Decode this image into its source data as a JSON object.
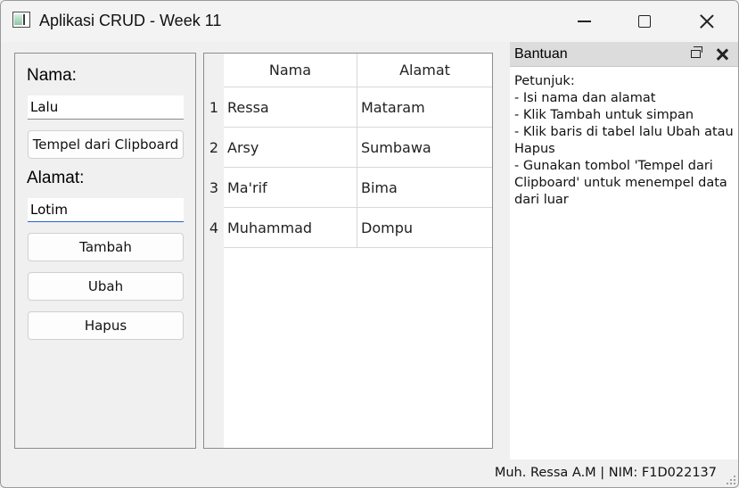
{
  "window": {
    "title": "Aplikasi CRUD - Week 11"
  },
  "form": {
    "nama_label": "Nama:",
    "nama_value": "Lalu",
    "paste_button": "Tempel dari Clipboard",
    "alamat_label": "Alamat:",
    "alamat_value": "Lotim",
    "tambah_button": "Tambah",
    "ubah_button": "Ubah",
    "hapus_button": "Hapus"
  },
  "table": {
    "headers": [
      "Nama",
      "Alamat"
    ],
    "rows": [
      {
        "num": "1",
        "nama": "Ressa",
        "alamat": "Mataram"
      },
      {
        "num": "2",
        "nama": "Arsy",
        "alamat": "Sumbawa"
      },
      {
        "num": "3",
        "nama": "Ma'rif",
        "alamat": "Bima"
      },
      {
        "num": "4",
        "nama": "Muhammad",
        "alamat": "Dompu"
      }
    ]
  },
  "help": {
    "title": "Bantuan",
    "lines": [
      "Petunjuk:",
      "- Isi nama dan alamat",
      "- Klik Tambah untuk simpan",
      "- Klik baris di tabel lalu Ubah atau",
      "Hapus",
      "- Gunakan tombol 'Tempel dari",
      "Clipboard' untuk menempel data",
      "dari luar"
    ]
  },
  "status": {
    "text": "Muh. Ressa A.M | NIM: F1D022137"
  },
  "icons": {
    "app": "app-window-icon",
    "minimize": "minimize-icon",
    "maximize": "maximize-icon",
    "close": "close-icon",
    "dock_float": "float-icon",
    "dock_close": "close-icon"
  },
  "colors": {
    "focus_underline": "#2a62c9"
  }
}
